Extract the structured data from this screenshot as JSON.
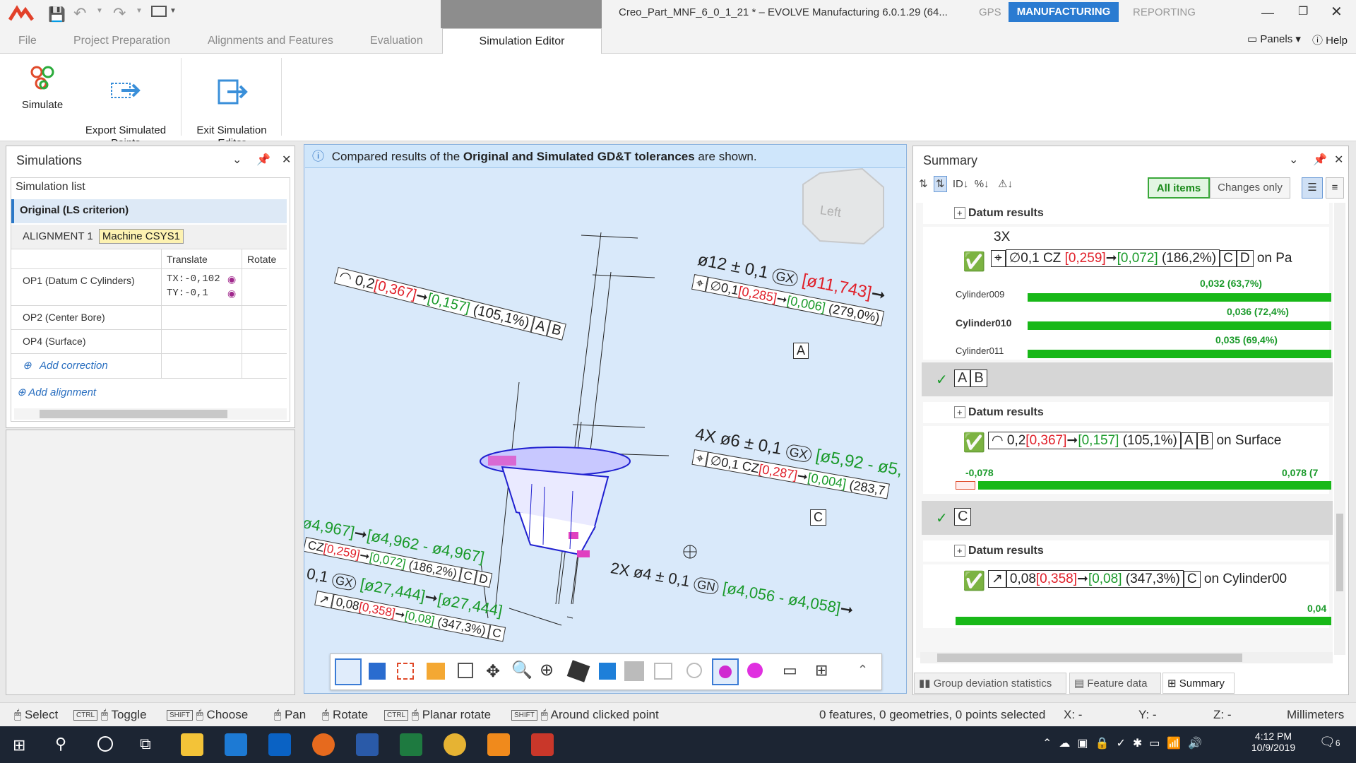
{
  "titlebar": {
    "doc_title": "Creo_Part_MNF_6_0_1_21 *  – EVOLVE Manufacturing 6.0.1.29 (64...",
    "modes": [
      "GPS",
      "MANUFACTURING",
      "REPORTING"
    ],
    "panels": "Panels",
    "help": "Help"
  },
  "ribbon_tabs": [
    "File",
    "Project Preparation",
    "Alignments and Features",
    "Evaluation",
    "Simulation Editor"
  ],
  "ribbon": {
    "simulate": "Simulate",
    "export": "Export Simulated\nPoints",
    "exit": "Exit Simulation\nEditor"
  },
  "simulations": {
    "title": "Simulations",
    "list_header": "Simulation list",
    "original": "Original (LS criterion)",
    "alignment": "ALIGNMENT 1",
    "csys": "Machine CSYS1",
    "col_translate": "Translate",
    "col_rotate": "Rotate",
    "rows": [
      {
        "name": "OP1 (Datum C Cylinders)",
        "tx": "TX:-0,102",
        "ty": "TY:-0,1"
      },
      {
        "name": "OP2 (Center Bore)"
      },
      {
        "name": "OP4 (Surface)"
      }
    ],
    "add_correction": "Add correction",
    "add_alignment": "Add alignment"
  },
  "info": {
    "pre": "Compared results of the ",
    "bold": "Original and Simulated GD&T tolerances",
    "post": " are shown."
  },
  "view": {
    "cube_label": "Left",
    "a1": {
      "val": "0,2",
      "red": "[0,367]",
      "grn": "[0,157]",
      "pct": "(105,1%)",
      "d1": "A",
      "d2": "B"
    },
    "a2": {
      "dim": "ø12 ± 0,1",
      "gx": "GX",
      "range": "[ø11,743]",
      "tol": "∅0,1",
      "red": "[0,285]",
      "grn": "[0,006]",
      "pct": "(279,0%)",
      "datum": "A"
    },
    "a3": {
      "dim": "4X  ø6 ± 0,1",
      "gx": "GX",
      "range": "[ø5,92 - ø5,",
      "tol": "∅0,1 CZ",
      "red": "[0,287]",
      "grn": "[0,004]",
      "pct": "(283,7",
      "datum": "C"
    },
    "a4": {
      "t1": "ø4,967]",
      "t2": "[ø4,962 - ø4,967]",
      "cz": "CZ",
      "red": "[0,259]",
      "grn": "[0,072]",
      "pct": "(186,2%)",
      "d1": "C",
      "d2": "D"
    },
    "a5": {
      "t1": "0,1",
      "gx": "GX",
      "rng": "[ø27,444]",
      "rng2": "[ø27,444]",
      "val": "0,08",
      "red": "[0,358]",
      "grn": "[0,08]",
      "pct": "(347,3%)",
      "d": "C"
    },
    "a6": {
      "dim": "2X  ø4 ± 0,1",
      "gn": "GN",
      "rng": "[ø4,056 - ø4,058]"
    }
  },
  "summary": {
    "title": "Summary",
    "all_items": "All items",
    "changes_only": "Changes only",
    "datum_results": "Datum results",
    "b1": {
      "mult": "3X",
      "tol": "∅0,1 CZ",
      "red": "[0,259]",
      "grn": "[0,072]",
      "pct": "(186,2%)",
      "d1": "C",
      "d2": "D",
      "on": "on Pa",
      "cyls": [
        {
          "name": "Cylinder009",
          "val": "0,032 (63,7%)",
          "frac": 0.637
        },
        {
          "name": "Cylinder010",
          "val": "0,036 (72,4%)",
          "frac": 0.724
        },
        {
          "name": "Cylinder011",
          "val": "0,035 (69,4%)",
          "frac": 0.694
        }
      ]
    },
    "g2": {
      "d1": "A",
      "d2": "B"
    },
    "b2": {
      "val": "0,2",
      "red": "[0,367]",
      "grn": "[0,157]",
      "pct": "(105,1%)",
      "d1": "A",
      "d2": "B",
      "on": "on Surface",
      "lo": "-0,078",
      "hi": "0,078 (7"
    },
    "g3": {
      "d1": "C"
    },
    "b3": {
      "val": "0,08",
      "red": "[0,358]",
      "grn": "[0,08]",
      "pct": "(347,3%)",
      "d": "C",
      "on": "on Cylinder00",
      "hi": "0,04"
    }
  },
  "bottom_tabs": [
    "Group deviation statistics",
    "Feature data",
    "Summary"
  ],
  "status": {
    "select": "Select",
    "ctrl": "CTRL",
    "toggle": "Toggle",
    "shift": "SHIFT",
    "choose": "Choose",
    "pan": "Pan",
    "rotate": "Rotate",
    "planar": "Planar rotate",
    "around": "Around clicked point",
    "sel_info": "0 features, 0 geometries, 0 points selected",
    "x": "X: -",
    "y": "Y: -",
    "z": "Z: -",
    "units": "Millimeters"
  },
  "taskbar": {
    "time": "4:12 PM",
    "date": "10/9/2019",
    "notif": "6"
  }
}
